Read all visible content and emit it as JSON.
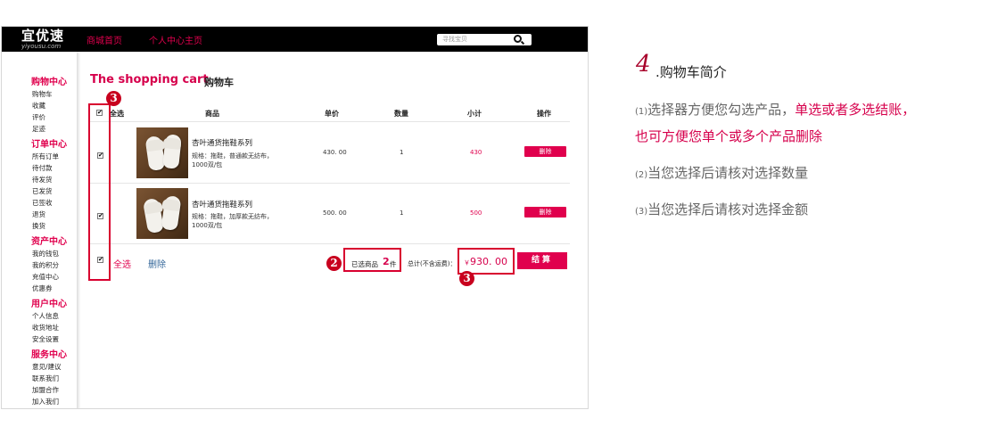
{
  "header": {
    "logo_text": "宜优速",
    "logo_sub": "yiyousu.com",
    "nav": [
      "商城首页",
      "个人中心主页"
    ],
    "search_placeholder": "寻找宝贝"
  },
  "sidebar": {
    "groups": [
      {
        "title": "购物中心",
        "items": [
          "购物车",
          "收藏",
          "评价",
          "足迹"
        ]
      },
      {
        "title": "订单中心",
        "items": [
          "所有订单",
          "待付款",
          "待发货",
          "已发货",
          "已签收",
          "退货",
          "换货"
        ]
      },
      {
        "title": "资产中心",
        "items": [
          "我的钱包",
          "我的积分",
          "充值中心",
          "优惠券"
        ]
      },
      {
        "title": "用户中心",
        "items": [
          "个人信息",
          "收货地址",
          "安全设置"
        ]
      },
      {
        "title": "服务中心",
        "items": [
          "意见/建议",
          "联系我们",
          "加盟合作",
          "加入我们"
        ]
      }
    ]
  },
  "cart": {
    "title_en": "The shopping cart",
    "title_cn": "购物车",
    "columns": {
      "select_all": "全选",
      "product": "商品",
      "price": "单价",
      "qty": "数量",
      "subtotal": "小计",
      "action": "操作"
    },
    "rows": [
      {
        "name": "杏叶通货拖鞋系列",
        "spec": "规格：拖鞋，普通款无纺布，1000双/包",
        "price": "430. 00",
        "qty": "1",
        "subtotal": "430",
        "delete": "删除",
        "checked": true
      },
      {
        "name": "杏叶通货拖鞋系列",
        "spec": "规格：拖鞋，加厚款无纺布，1000双/包",
        "price": "500. 00",
        "qty": "1",
        "subtotal": "500",
        "delete": "删除",
        "checked": true
      }
    ],
    "footer": {
      "select_all": "全选",
      "delete": "删除",
      "selected_label": "已选商品",
      "selected_count": "2",
      "selected_unit": "件",
      "total_label": "总计(不含运费)：",
      "currency": "￥",
      "total_value": "930. 00",
      "checkout": "结算"
    }
  },
  "markers": {
    "m1": "3",
    "m2": "2",
    "m3": "3"
  },
  "intro": {
    "number": "4",
    "title": ".购物车简介",
    "line1_prefix": "(1)",
    "line1_text": "选择器方便您勾选产品，",
    "line1_highlight": "单选或者多选结账，",
    "line2_highlight": "也可方便您单个或多个产品删除",
    "line3_prefix": "(2)",
    "line3_text": "当您选择后请核对选择数量",
    "line4_prefix": "(3)",
    "line4_text": "当您选择后请核对选择金额"
  },
  "colors": {
    "accent": "#e0004d",
    "marker": "#c8001e",
    "header_bg": "#000000"
  }
}
